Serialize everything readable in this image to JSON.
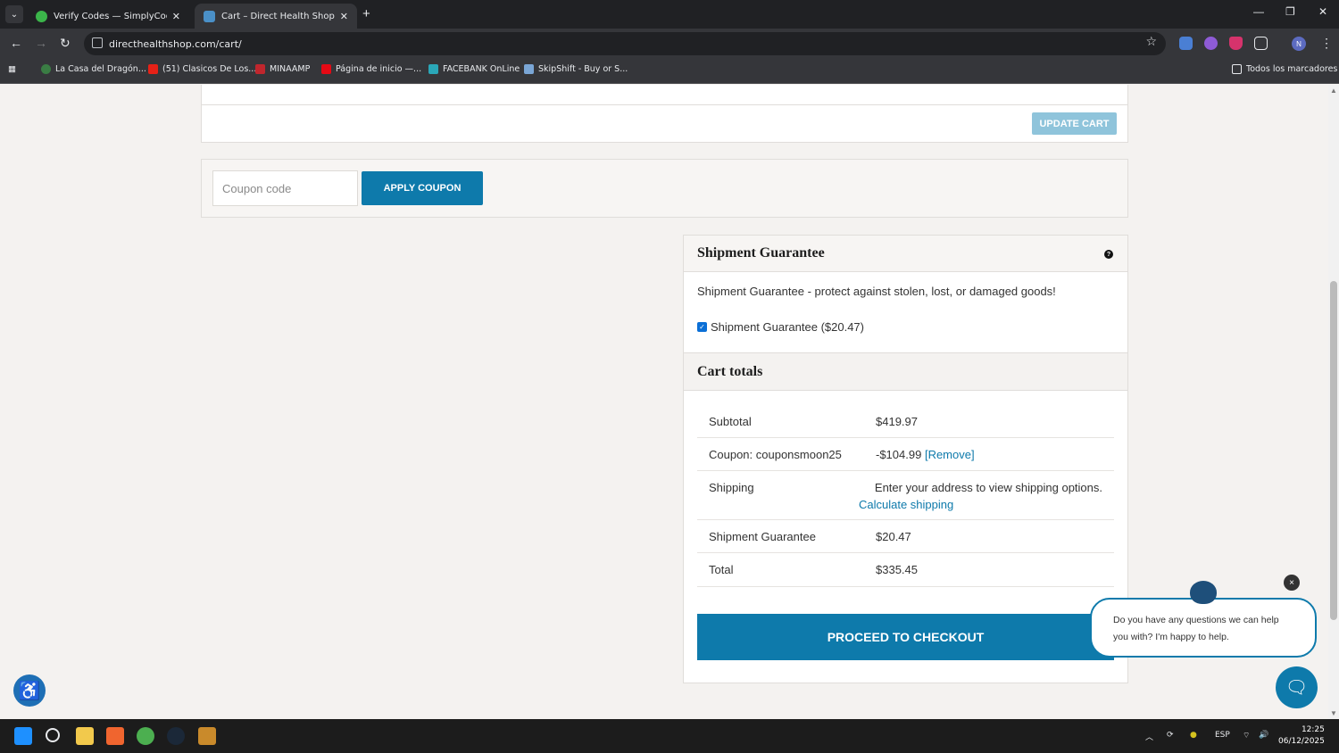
{
  "browser": {
    "tabs": [
      {
        "title": "Verify Codes — SimplyCodes",
        "active": false
      },
      {
        "title": "Cart – Direct Health Shop",
        "active": true
      }
    ],
    "url": "directhealthshop.com/cart/",
    "bookmarks": [
      "La Casa del Dragón...",
      "(51) Clasicos De Los...",
      "MINAAMP",
      "Página de inicio —...",
      "FACEBANK OnLine",
      "SkipShift - Buy or S..."
    ],
    "all_bookmarks": "Todos los marcadores",
    "profile_initial": "N"
  },
  "cart": {
    "update_label": "UPDATE CART",
    "coupon_placeholder": "Coupon code",
    "apply_coupon_label": "APPLY COUPON"
  },
  "shipment_guarantee": {
    "title": "Shipment Guarantee",
    "help": "?",
    "description": "Shipment Guarantee - protect against stolen, lost, or damaged goods!",
    "checkbox_label": "Shipment Guarantee ($20.47)",
    "checked": true
  },
  "cart_totals": {
    "title": "Cart totals",
    "subtotal_label": "Subtotal",
    "subtotal_value": "$419.97",
    "coupon_label": "Coupon: couponsmoon25",
    "coupon_value": "-$104.99",
    "coupon_remove": "[Remove]",
    "shipping_label": "Shipping",
    "shipping_text": "Enter your address to view shipping options.",
    "shipping_link": "Calculate shipping",
    "guarantee_label": "Shipment Guarantee",
    "guarantee_value": "$20.47",
    "total_label": "Total",
    "total_value": "$335.45",
    "checkout_label": "PROCEED TO CHECKOUT"
  },
  "chat": {
    "message": "Do you have any questions we can help you with? I'm happy to help.",
    "close": "×"
  },
  "taskbar": {
    "language": "ESP",
    "time": "12:25",
    "date": "06/12/2025"
  }
}
